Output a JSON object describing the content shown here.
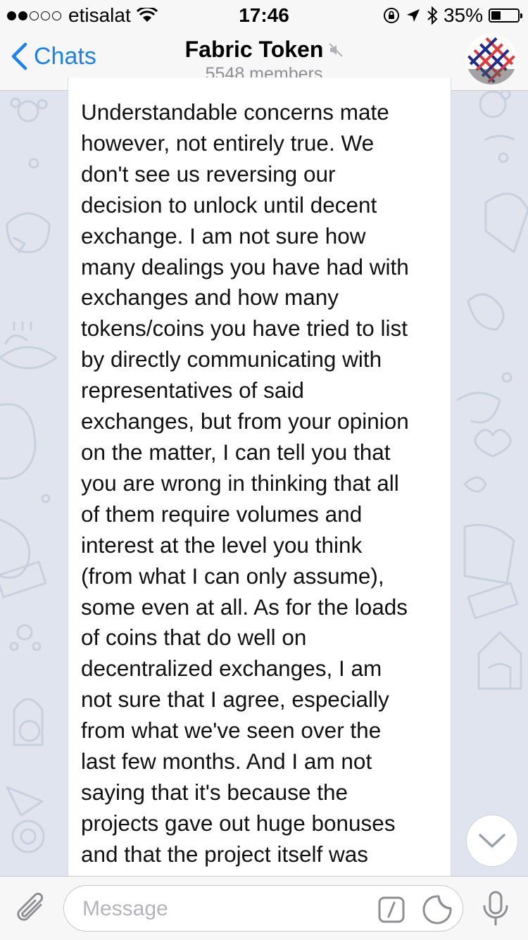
{
  "status_bar": {
    "carrier": "etisalat",
    "time": "17:46",
    "battery": "35%",
    "battery_level": 0.35,
    "signal_bars_filled": 2,
    "signal_bars_total": 5
  },
  "nav": {
    "back_label": "Chats",
    "title": "Fabric Token",
    "subtitle": "5548 members",
    "muted_icon": "speaker-muted-icon",
    "avatar_icon": "group-avatar"
  },
  "message": {
    "text": "Understandable concerns mate\nhowever, not entirely true. We\ndon't see us reversing our\ndecision to unlock until decent\nexchange. I am not sure how\nmany dealings you have had with\nexchanges and how many\ntokens/coins you have tried to list\nby directly communicating with\nrepresentatives of said\nexchanges, but from your opinion\non the matter, I can tell you that\nyou are wrong in thinking that all\nof them require volumes and\ninterest at the level you think\n(from what I can only assume),\nsome even at all. As for the loads\nof coins that do well on\ndecentralized exchanges, I am\nnot sure that I agree, especially\nfrom what we've seen over the\nlast few months. And I am not\nsaying that it's because the\nprojects gave out huge bonuses\nand that the project itself was"
  },
  "input": {
    "placeholder": "Message"
  },
  "colors": {
    "accent": "#1a82f0",
    "wallpaper": "#dfe4ee",
    "bar_bg": "#f7f7f7"
  }
}
